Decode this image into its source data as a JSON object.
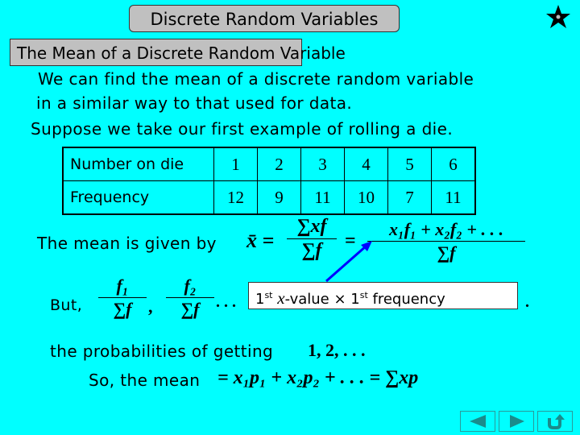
{
  "header": {
    "title": "Discrete Random Variables",
    "subtitle": "The Mean of a Discrete Random Variable"
  },
  "intro": {
    "line1": "We can find the mean of a discrete random variable",
    "line2": "in a similar way to that used for data.",
    "line3": "Suppose we take our first example of rolling a die."
  },
  "table": {
    "row_labels": [
      "Number on die",
      "Frequency"
    ],
    "numbers": [
      "1",
      "2",
      "3",
      "4",
      "5",
      "6"
    ],
    "frequencies": [
      "12",
      "9",
      "11",
      "10",
      "7",
      "11"
    ]
  },
  "mean_formula": {
    "label": "The mean is given by",
    "lhs": "x̄ =",
    "frac1_num": "∑xf",
    "frac1_den": "∑f",
    "eq": "=",
    "frac2_num": "x₁f₁ + x₂f₂ + . . .",
    "frac2_den": "∑f"
  },
  "but_row": {
    "label": "But,",
    "frac_a_num": "f₁",
    "frac_b_num": "f₂",
    "den": "∑f",
    "comma": ",",
    "ellipsis": ". . .",
    "trailing": "."
  },
  "callout": {
    "part1": "1",
    "sup1": "st",
    "var": "x",
    "part2": "-value × 1",
    "sup2": "st",
    "part3": " frequency"
  },
  "probabilities_line": {
    "text": "the probabilities of getting",
    "values": "1, 2, . . ."
  },
  "conclusion": {
    "text": "So, the mean",
    "formula": "= x₁p₁ + x₂p₂ + . . . = ∑xp"
  },
  "nav": {
    "back": "previous-slide",
    "forward": "next-slide",
    "return": "return"
  },
  "colors": {
    "background": "#00FFFF",
    "title_box": "#C0C0C0",
    "arrow": "#0000FF",
    "nav_icon": "#1B8B8B"
  }
}
